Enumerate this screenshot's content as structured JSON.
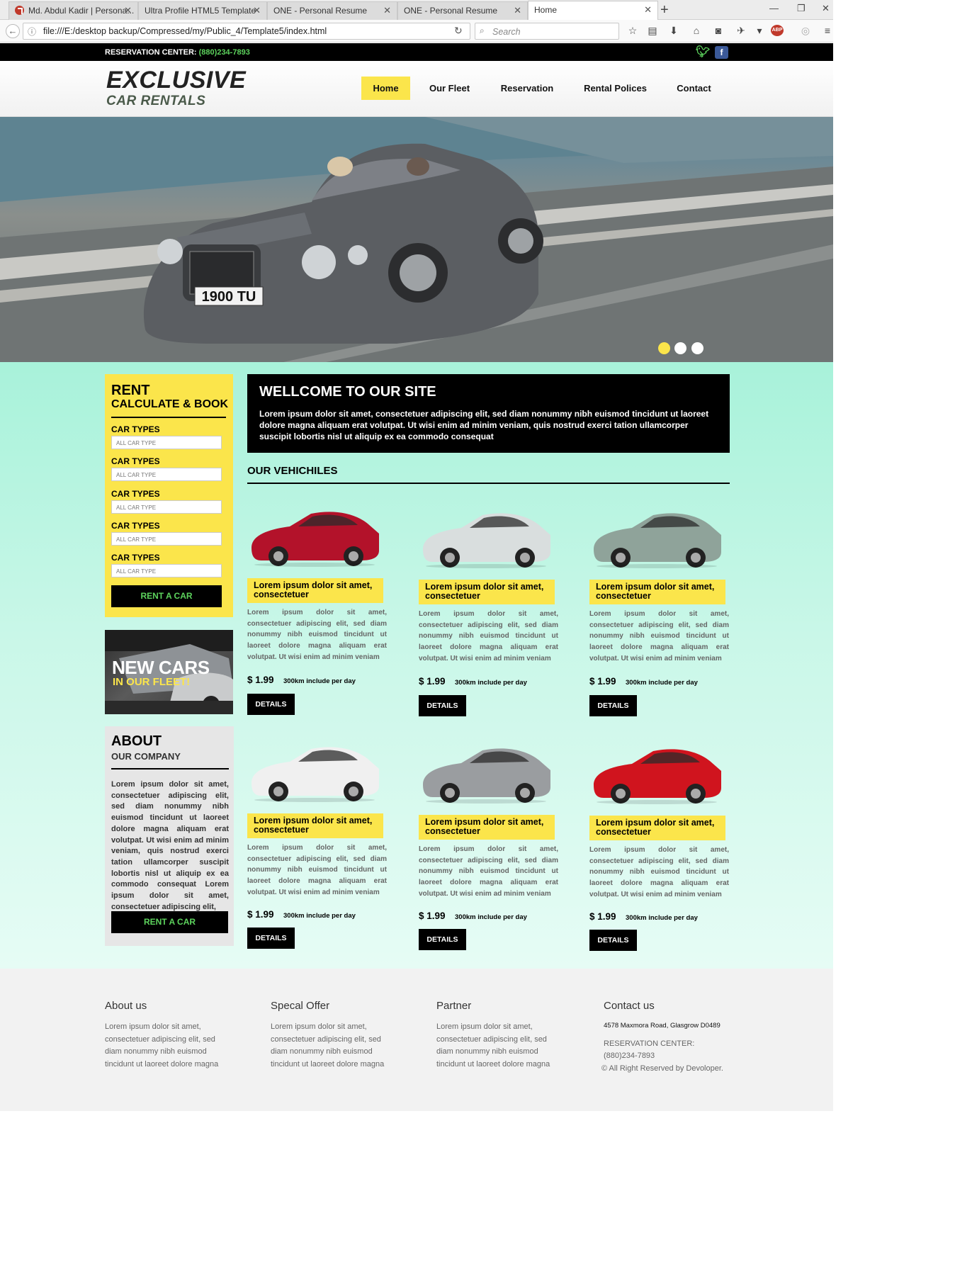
{
  "browser": {
    "tabs": [
      {
        "title": "Md. Abdul Kadir | Persona..."
      },
      {
        "title": "Ultra Profile HTML5 Template"
      },
      {
        "title": "ONE - Personal Resume"
      },
      {
        "title": "ONE - Personal Resume"
      },
      {
        "title": "Home"
      }
    ],
    "url": "file:///E:/desktop backup/Compressed/my/Public_4/Template5/index.html",
    "search_placeholder": "Search"
  },
  "topbar": {
    "reservation_label": "RESERVATION CENTER:",
    "reservation_phone": "(880)234-7893"
  },
  "logo": {
    "line1": "EXCLUSIVE",
    "line2": "CAR RENTALS"
  },
  "nav": [
    {
      "label": "Home"
    },
    {
      "label": "Our Fleet"
    },
    {
      "label": "Reservation"
    },
    {
      "label": "Rental Polices"
    },
    {
      "label": "Contact"
    }
  ],
  "hero": {
    "plate": "1900 TU",
    "slides": 3,
    "active_slide": 1
  },
  "rent": {
    "title": "RENT",
    "subtitle": "CALCULATE & BOOK",
    "fields": [
      {
        "label": "CAR TYPES",
        "value": "ALL CAR TYPE"
      },
      {
        "label": "CAR TYPES",
        "value": "ALL CAR TYPE"
      },
      {
        "label": "CAR TYPES",
        "value": "ALL CAR TYPE"
      },
      {
        "label": "CAR TYPES",
        "value": "ALL CAR TYPE"
      },
      {
        "label": "CAR TYPES",
        "value": "ALL CAR TYPE"
      }
    ],
    "button": "RENT A CAR"
  },
  "promo": {
    "line1": "NEW CARS",
    "line2": "IN OUR FLEET!"
  },
  "about": {
    "title": "ABOUT",
    "subtitle": "OUR COMPANY",
    "text": "Lorem ipsum dolor sit amet, consectetuer adipiscing elit, sed diam nonummy nibh euismod tincidunt ut laoreet dolore magna aliquam erat volutpat. Ut wisi enim ad minim veniam, quis nostrud exerci tation ullamcorper suscipit lobortis nisl ut aliquip ex ea commodo consequat Lorem ipsum dolor sit amet, consectetuer adipiscing elit,",
    "button": "RENT A CAR"
  },
  "welcome": {
    "title": "WELLCOME TO OUR SITE",
    "text": "Lorem ipsum dolor sit amet, consectetuer adipiscing elit, sed diam nonummy nibh euismod tincidunt ut laoreet dolore magna aliquam erat volutpat. Ut wisi enim ad minim veniam, quis nostrud exerci tation ullamcorper suscipit lobortis nisl ut aliquip ex ea commodo consequat"
  },
  "vehicles": {
    "title": "OUR VEHICHILES",
    "items": [
      {
        "caption": "Lorem ipsum dolor sit amet, consectetuer",
        "desc": "Lorem ipsum dolor sit amet, consectetuer adipiscing elit, sed diam nonummy nibh euismod tincidunt ut laoreet dolore magna aliquam erat volutpat. Ut wisi enim ad minim veniam",
        "price": "$ 1.99",
        "per": "300km include per day",
        "button": "DETAILS",
        "color": "#b3122a"
      },
      {
        "caption": "Lorem ipsum dolor sit amet, consectetuer",
        "desc": "Lorem ipsum dolor sit amet, consectetuer adipiscing elit, sed diam nonummy nibh euismod tincidunt ut laoreet dolore magna aliquam erat volutpat. Ut wisi enim ad minim veniam",
        "price": "$ 1.99",
        "per": "300km include per day",
        "button": "DETAILS",
        "color": "#d9dede"
      },
      {
        "caption": "Lorem ipsum dolor sit amet, consectetuer",
        "desc": "Lorem ipsum dolor sit amet, consectetuer adipiscing elit, sed diam nonummy nibh euismod tincidunt ut laoreet dolore magna aliquam erat volutpat. Ut wisi enim ad minim veniam",
        "price": "$ 1.99",
        "per": "300km include per day",
        "button": "DETAILS",
        "color": "#8fa39a"
      },
      {
        "caption": "Lorem ipsum dolor sit amet, consectetuer",
        "desc": "Lorem ipsum dolor sit amet, consectetuer adipiscing elit, sed diam nonummy nibh euismod tincidunt ut laoreet dolore magna aliquam erat volutpat. Ut wisi enim ad minim veniam",
        "price": "$ 1.99",
        "per": "300km include per day",
        "button": "DETAILS",
        "color": "#f0f0f0"
      },
      {
        "caption": "Lorem ipsum dolor sit amet, consectetuer",
        "desc": "Lorem ipsum dolor sit amet, consectetuer adipiscing elit, sed diam nonummy nibh euismod tincidunt ut laoreet dolore magna aliquam erat volutpat. Ut wisi enim ad minim veniam",
        "price": "$ 1.99",
        "per": "300km include per day",
        "button": "DETAILS",
        "color": "#9a9da0"
      },
      {
        "caption": "Lorem ipsum dolor sit amet, consectetuer",
        "desc": "Lorem ipsum dolor sit amet, consectetuer adipiscing elit, sed diam nonummy nibh euismod tincidunt ut laoreet dolore magna aliquam erat volutpat. Ut wisi enim ad minim veniam",
        "price": "$ 1.99",
        "per": "300km include per day",
        "button": "DETAILS",
        "color": "#d0141e"
      }
    ]
  },
  "footer": {
    "columns": [
      {
        "title": "About us",
        "text": "Lorem ipsum dolor sit amet, consectetuer adipiscing elit, sed diam nonummy nibh euismod tincidunt ut laoreet dolore magna"
      },
      {
        "title": "Specal Offer",
        "text": "Lorem ipsum dolor sit amet, consectetuer adipiscing elit, sed diam nonummy nibh euismod tincidunt ut laoreet dolore magna"
      },
      {
        "title": "Partner",
        "text": "Lorem ipsum dolor sit amet, consectetuer adipiscing elit, sed diam nonummy nibh euismod tincidunt ut laoreet dolore magna"
      }
    ],
    "contact": {
      "title": "Contact us",
      "address": "4578 Maxmora Road, Glasgrow D0489",
      "reservation_label": "RESERVATION CENTER:",
      "phone": "(880)234-7893",
      "copyright": "© All Right Reserved by Devoloper."
    }
  },
  "colors": {
    "accent": "#fbe54b",
    "black": "#000000",
    "green": "#5dd35d",
    "mint": "#a8f2da"
  }
}
